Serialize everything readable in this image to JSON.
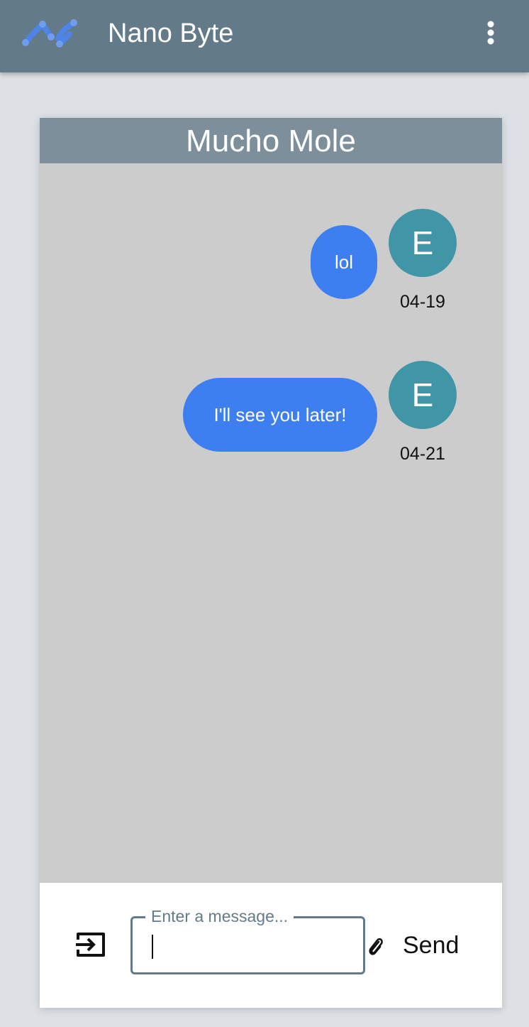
{
  "app": {
    "title": "Nano Byte",
    "logo_icon": "nano-logo-icon",
    "menu_icon": "more-vert-icon"
  },
  "chat": {
    "title": "Mucho Mole",
    "messages": [
      {
        "text": "lol",
        "avatar": "E",
        "date": "04-19"
      },
      {
        "text": "I'll see you later!",
        "avatar": "E",
        "date": "04-21"
      }
    ]
  },
  "composer": {
    "placeholder": "Enter a message...",
    "value": "",
    "send_label": "Send",
    "exit_icon": "exit-to-app-icon",
    "attach_icon": "paperclip-icon"
  },
  "colors": {
    "appbar": "#637b89",
    "header": "#7d8f9a",
    "chat_background": "#cccccc",
    "bubble": "#3d7ff1",
    "avatar": "#4096a6",
    "page_background": "#dde1e5"
  }
}
